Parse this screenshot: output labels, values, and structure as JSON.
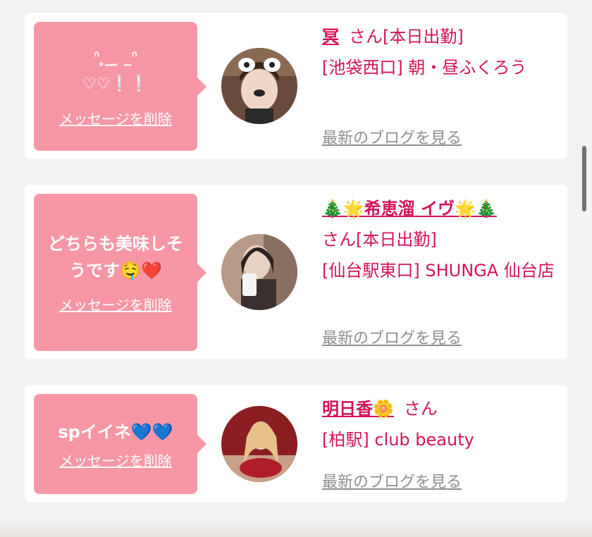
{
  "messages": [
    {
      "message": "ᐢ ̥_ ̫ _ᐢ\n♡♡❕❕",
      "delete_label": "メッセージを削除",
      "name": "冥",
      "san": "さん[本日出勤]",
      "shop": "[池袋西口] 朝・昼ふくろう",
      "blog_label": "最新のブログを見る"
    },
    {
      "message": "どちらも美味しそうです🤤❤️",
      "delete_label": "メッセージを削除",
      "name": "🎄🌟希恵溜 イヴ🌟🎄",
      "san": "さん[本日出勤]",
      "shop": "[仙台駅東口] SHUNGA 仙台店",
      "blog_label": "最新のブログを見る"
    },
    {
      "message": "spイイネ💙💙",
      "delete_label": "メッセージを削除",
      "name": "明日香🌼",
      "san": "さん",
      "shop": "[柏駅] club beauty",
      "blog_label": "最新のブログを見る"
    }
  ],
  "colors": {
    "bubble": "#f797a6",
    "accent": "#d4145a",
    "link_gray": "#8e8e8e",
    "background": "#f2f2f2"
  }
}
